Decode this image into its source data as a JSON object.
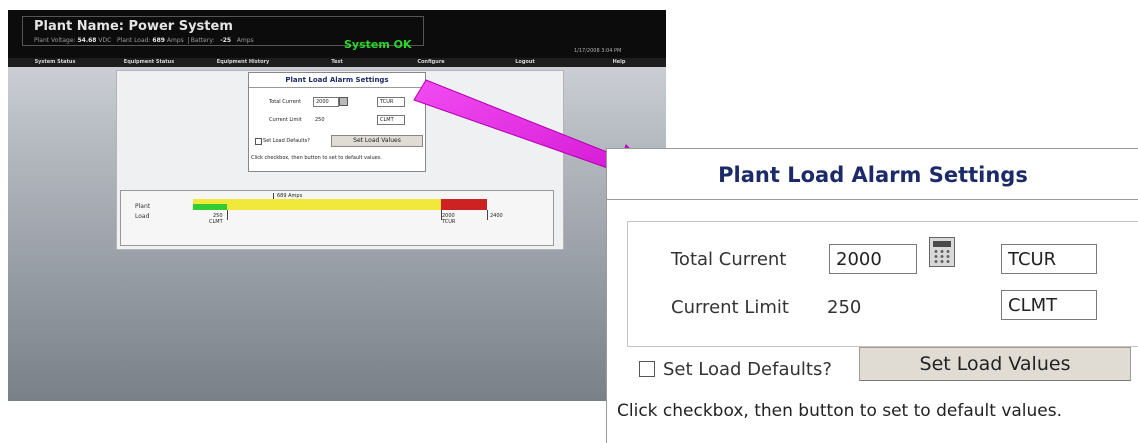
{
  "header": {
    "plant_name_label": "Plant Name:",
    "plant_name": "Power System",
    "plant_voltage_label": "Plant Voltage:",
    "plant_voltage": "54.68",
    "plant_voltage_unit": "VDC",
    "plant_load_label": "Plant Load:",
    "plant_load": "689",
    "plant_load_unit": "Amps",
    "battery_label": "Battery:",
    "battery": "-25",
    "battery_unit": "Amps",
    "status": "System OK",
    "datetime": "1/17/2008 3:04 PM"
  },
  "nav": {
    "items": [
      "System Status",
      "Equipment Status",
      "Equipment History",
      "Test",
      "Configure",
      "Logout",
      "Help"
    ]
  },
  "settings": {
    "title": "Plant Load Alarm Settings",
    "total_current_label": "Total Current",
    "total_current_value": "2000",
    "total_current_code": "TCUR",
    "current_limit_label": "Current Limit",
    "current_limit_value": "250",
    "current_limit_code": "CLMT",
    "defaults_checkbox_label": "Set Load Defaults?",
    "set_button": "Set Load Values",
    "help_text": "Click checkbox, then button to set to default values."
  },
  "load_bar": {
    "label_line1": "Plant",
    "label_line2": "Load",
    "current_value": "689 Amps",
    "marker_clmt_value": "250",
    "marker_clmt_code": "CLMT",
    "marker_tcur_value": "2000",
    "marker_tcur_code": "TCUR",
    "max_value": "2400",
    "load_fraction": 0.287
  },
  "colors": {
    "ok_green": "#28d828",
    "title_navy": "#1c2a6a",
    "arrow_magenta": "#e61ee6",
    "bar_green": "#33cc33",
    "bar_yellow": "#f0e83a",
    "bar_red": "#cc2222"
  },
  "icons": {
    "calculator": "calculator-icon",
    "arrow": "callout-arrow"
  }
}
